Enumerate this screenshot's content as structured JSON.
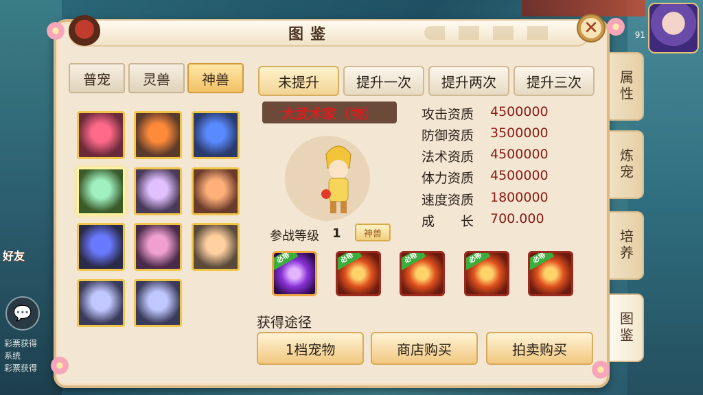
{
  "hud": {
    "level": "91",
    "friends_label": "好友",
    "chat_ticker": [
      "彩票获得",
      "系统",
      "彩票获得"
    ]
  },
  "window": {
    "title": "图鉴",
    "close_icon": "close-icon"
  },
  "categories": [
    {
      "label": "普宠",
      "active": false
    },
    {
      "label": "灵兽",
      "active": false
    },
    {
      "label": "神兽",
      "active": true
    }
  ],
  "upgrade_tabs": [
    {
      "label": "未提升",
      "active": true
    },
    {
      "label": "提升一次",
      "active": false
    },
    {
      "label": "提升两次",
      "active": false
    },
    {
      "label": "提升三次",
      "active": false
    }
  ],
  "pet_grid": [
    {
      "icon": "red-warrior-pet",
      "selected": false
    },
    {
      "icon": "armored-hero-pet",
      "selected": false
    },
    {
      "icon": "blue-beast-pet",
      "selected": false
    },
    {
      "icon": "goddess-pet",
      "selected": true
    },
    {
      "icon": "dancer-pet",
      "selected": false
    },
    {
      "icon": "golden-pig-pet",
      "selected": false
    },
    {
      "icon": "ninja-pet",
      "selected": false
    },
    {
      "icon": "purple-warrior-pet",
      "selected": false
    },
    {
      "icon": "pig-face-pet",
      "selected": false
    },
    {
      "icon": "silver-dragon-pet",
      "selected": false
    },
    {
      "icon": "silver-dragon-pet-2",
      "selected": false
    }
  ],
  "pet": {
    "name": "大武术家（物）",
    "battle_level_label": "参战等级",
    "battle_level": "1",
    "rank_badge": "神兽"
  },
  "stats": [
    {
      "label": "攻击资质",
      "value": "4500000"
    },
    {
      "label": "防御资质",
      "value": "3500000"
    },
    {
      "label": "法术资质",
      "value": "4500000"
    },
    {
      "label": "体力资质",
      "value": "4500000"
    },
    {
      "label": "速度资质",
      "value": "1800000"
    },
    {
      "label": "成　　长",
      "value": "700.000"
    }
  ],
  "skills": [
    {
      "tag": "必带",
      "icon": "purple-vortex-skill"
    },
    {
      "tag": "必带",
      "icon": "golden-fist-skill"
    },
    {
      "tag": "必带",
      "icon": "red-bull-skill"
    },
    {
      "tag": "必带",
      "icon": "fire-slash-skill"
    },
    {
      "tag": "必带",
      "icon": "flame-warrior-skill"
    }
  ],
  "obtain": {
    "label": "获得途径",
    "buttons": [
      "1档宠物",
      "商店购买",
      "拍卖购买"
    ]
  },
  "side_tabs": [
    {
      "label": "属性",
      "active": false
    },
    {
      "label": "炼宠",
      "active": false
    },
    {
      "label": "培养",
      "active": false
    },
    {
      "label": "图鉴",
      "active": true
    }
  ]
}
